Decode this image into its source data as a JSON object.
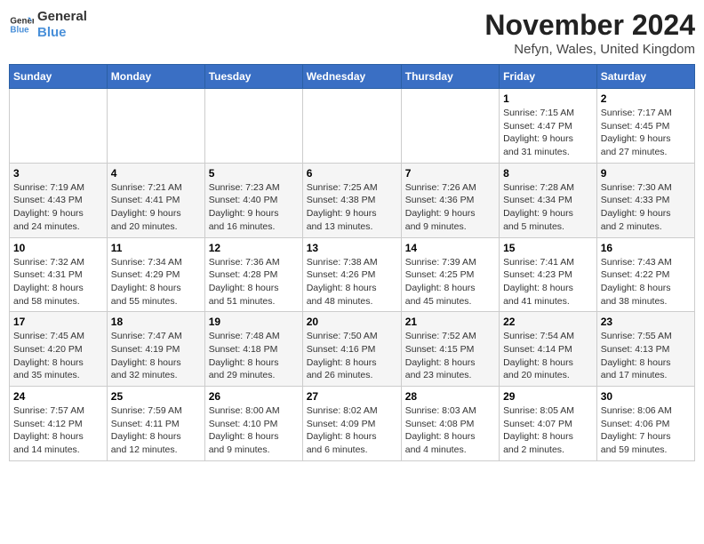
{
  "logo": {
    "line1": "General",
    "line2": "Blue"
  },
  "title": "November 2024",
  "location": "Nefyn, Wales, United Kingdom",
  "days_of_week": [
    "Sunday",
    "Monday",
    "Tuesday",
    "Wednesday",
    "Thursday",
    "Friday",
    "Saturday"
  ],
  "weeks": [
    [
      {
        "day": "",
        "info": ""
      },
      {
        "day": "",
        "info": ""
      },
      {
        "day": "",
        "info": ""
      },
      {
        "day": "",
        "info": ""
      },
      {
        "day": "",
        "info": ""
      },
      {
        "day": "1",
        "info": "Sunrise: 7:15 AM\nSunset: 4:47 PM\nDaylight: 9 hours\nand 31 minutes."
      },
      {
        "day": "2",
        "info": "Sunrise: 7:17 AM\nSunset: 4:45 PM\nDaylight: 9 hours\nand 27 minutes."
      }
    ],
    [
      {
        "day": "3",
        "info": "Sunrise: 7:19 AM\nSunset: 4:43 PM\nDaylight: 9 hours\nand 24 minutes."
      },
      {
        "day": "4",
        "info": "Sunrise: 7:21 AM\nSunset: 4:41 PM\nDaylight: 9 hours\nand 20 minutes."
      },
      {
        "day": "5",
        "info": "Sunrise: 7:23 AM\nSunset: 4:40 PM\nDaylight: 9 hours\nand 16 minutes."
      },
      {
        "day": "6",
        "info": "Sunrise: 7:25 AM\nSunset: 4:38 PM\nDaylight: 9 hours\nand 13 minutes."
      },
      {
        "day": "7",
        "info": "Sunrise: 7:26 AM\nSunset: 4:36 PM\nDaylight: 9 hours\nand 9 minutes."
      },
      {
        "day": "8",
        "info": "Sunrise: 7:28 AM\nSunset: 4:34 PM\nDaylight: 9 hours\nand 5 minutes."
      },
      {
        "day": "9",
        "info": "Sunrise: 7:30 AM\nSunset: 4:33 PM\nDaylight: 9 hours\nand 2 minutes."
      }
    ],
    [
      {
        "day": "10",
        "info": "Sunrise: 7:32 AM\nSunset: 4:31 PM\nDaylight: 8 hours\nand 58 minutes."
      },
      {
        "day": "11",
        "info": "Sunrise: 7:34 AM\nSunset: 4:29 PM\nDaylight: 8 hours\nand 55 minutes."
      },
      {
        "day": "12",
        "info": "Sunrise: 7:36 AM\nSunset: 4:28 PM\nDaylight: 8 hours\nand 51 minutes."
      },
      {
        "day": "13",
        "info": "Sunrise: 7:38 AM\nSunset: 4:26 PM\nDaylight: 8 hours\nand 48 minutes."
      },
      {
        "day": "14",
        "info": "Sunrise: 7:39 AM\nSunset: 4:25 PM\nDaylight: 8 hours\nand 45 minutes."
      },
      {
        "day": "15",
        "info": "Sunrise: 7:41 AM\nSunset: 4:23 PM\nDaylight: 8 hours\nand 41 minutes."
      },
      {
        "day": "16",
        "info": "Sunrise: 7:43 AM\nSunset: 4:22 PM\nDaylight: 8 hours\nand 38 minutes."
      }
    ],
    [
      {
        "day": "17",
        "info": "Sunrise: 7:45 AM\nSunset: 4:20 PM\nDaylight: 8 hours\nand 35 minutes."
      },
      {
        "day": "18",
        "info": "Sunrise: 7:47 AM\nSunset: 4:19 PM\nDaylight: 8 hours\nand 32 minutes."
      },
      {
        "day": "19",
        "info": "Sunrise: 7:48 AM\nSunset: 4:18 PM\nDaylight: 8 hours\nand 29 minutes."
      },
      {
        "day": "20",
        "info": "Sunrise: 7:50 AM\nSunset: 4:16 PM\nDaylight: 8 hours\nand 26 minutes."
      },
      {
        "day": "21",
        "info": "Sunrise: 7:52 AM\nSunset: 4:15 PM\nDaylight: 8 hours\nand 23 minutes."
      },
      {
        "day": "22",
        "info": "Sunrise: 7:54 AM\nSunset: 4:14 PM\nDaylight: 8 hours\nand 20 minutes."
      },
      {
        "day": "23",
        "info": "Sunrise: 7:55 AM\nSunset: 4:13 PM\nDaylight: 8 hours\nand 17 minutes."
      }
    ],
    [
      {
        "day": "24",
        "info": "Sunrise: 7:57 AM\nSunset: 4:12 PM\nDaylight: 8 hours\nand 14 minutes."
      },
      {
        "day": "25",
        "info": "Sunrise: 7:59 AM\nSunset: 4:11 PM\nDaylight: 8 hours\nand 12 minutes."
      },
      {
        "day": "26",
        "info": "Sunrise: 8:00 AM\nSunset: 4:10 PM\nDaylight: 8 hours\nand 9 minutes."
      },
      {
        "day": "27",
        "info": "Sunrise: 8:02 AM\nSunset: 4:09 PM\nDaylight: 8 hours\nand 6 minutes."
      },
      {
        "day": "28",
        "info": "Sunrise: 8:03 AM\nSunset: 4:08 PM\nDaylight: 8 hours\nand 4 minutes."
      },
      {
        "day": "29",
        "info": "Sunrise: 8:05 AM\nSunset: 4:07 PM\nDaylight: 8 hours\nand 2 minutes."
      },
      {
        "day": "30",
        "info": "Sunrise: 8:06 AM\nSunset: 4:06 PM\nDaylight: 7 hours\nand 59 minutes."
      }
    ]
  ]
}
